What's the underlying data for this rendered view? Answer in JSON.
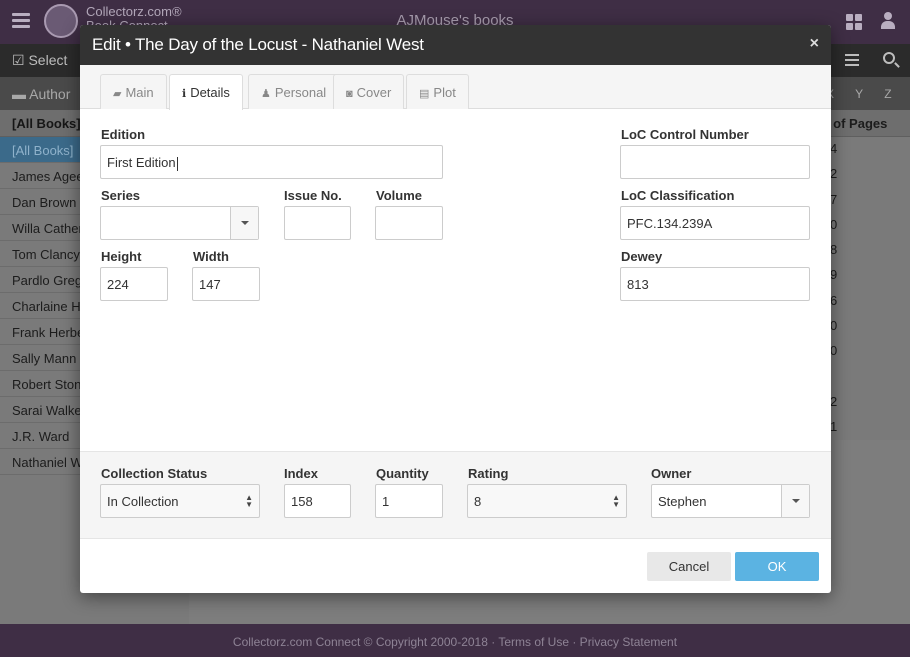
{
  "app": {
    "brand_line1": "Collectorz.com®",
    "brand_line2": "Book Connect",
    "title": "AJMouse's books",
    "toolbar_select": "Select",
    "author_label": "Author",
    "letters": "X Y Z"
  },
  "sidebar": {
    "header": "[All Books]",
    "items": [
      {
        "label": "[All Books]"
      },
      {
        "label": "James Agee"
      },
      {
        "label": "Dan Brown"
      },
      {
        "label": "Willa Cather"
      },
      {
        "label": "Tom Clancy"
      },
      {
        "label": "Pardlo Gregory"
      },
      {
        "label": "Charlaine Harris"
      },
      {
        "label": "Frank Herbert"
      },
      {
        "label": "Sally Mann"
      },
      {
        "label": "Robert Stone"
      },
      {
        "label": "Sarai Walker"
      },
      {
        "label": "J.R. Ward"
      },
      {
        "label": "Nathaniel West"
      }
    ]
  },
  "rightcol": {
    "header": "o. of Pages",
    "cells": [
      "4",
      "2",
      "7",
      "0",
      "8",
      "9",
      "6",
      "0",
      "0",
      "",
      "2",
      "1"
    ]
  },
  "footer": "Collectorz.com Connect © Copyright 2000-2018 · Terms of Use · Privacy Statement",
  "dialog": {
    "title": "Edit • The Day of the Locust - Nathaniel West",
    "close": "×",
    "tabs": [
      {
        "label": "Main",
        "icon": "book-icon",
        "glyph": "▰"
      },
      {
        "label": "Details",
        "icon": "info-icon",
        "glyph": "ℹ"
      },
      {
        "label": "Personal",
        "icon": "user-icon",
        "glyph": "♟"
      },
      {
        "label": "Cover",
        "icon": "camera-icon",
        "glyph": "◙"
      },
      {
        "label": "Plot",
        "icon": "file-icon",
        "glyph": "▤"
      }
    ],
    "active_tab": "Details",
    "fields": {
      "edition": {
        "label": "Edition",
        "value": "First Edition"
      },
      "series": {
        "label": "Series",
        "value": ""
      },
      "issue_no": {
        "label": "Issue No.",
        "value": ""
      },
      "volume": {
        "label": "Volume",
        "value": ""
      },
      "height": {
        "label": "Height",
        "value": "224"
      },
      "width": {
        "label": "Width",
        "value": "147"
      },
      "loc_control": {
        "label": "LoC Control Number",
        "value": ""
      },
      "loc_class": {
        "label": "LoC Classification",
        "value": "PFC.134.239A"
      },
      "dewey": {
        "label": "Dewey",
        "value": "813"
      },
      "collection_status": {
        "label": "Collection Status",
        "value": "In Collection"
      },
      "index": {
        "label": "Index",
        "value": "158"
      },
      "quantity": {
        "label": "Quantity",
        "value": "1"
      },
      "rating": {
        "label": "Rating",
        "value": "8"
      },
      "owner": {
        "label": "Owner",
        "value": "Stephen"
      }
    },
    "buttons": {
      "cancel": "Cancel",
      "ok": "OK"
    }
  },
  "colors": {
    "topbar": "#3f2e45",
    "ok_button": "#5bb3e2",
    "dialog_header": "#333333"
  }
}
